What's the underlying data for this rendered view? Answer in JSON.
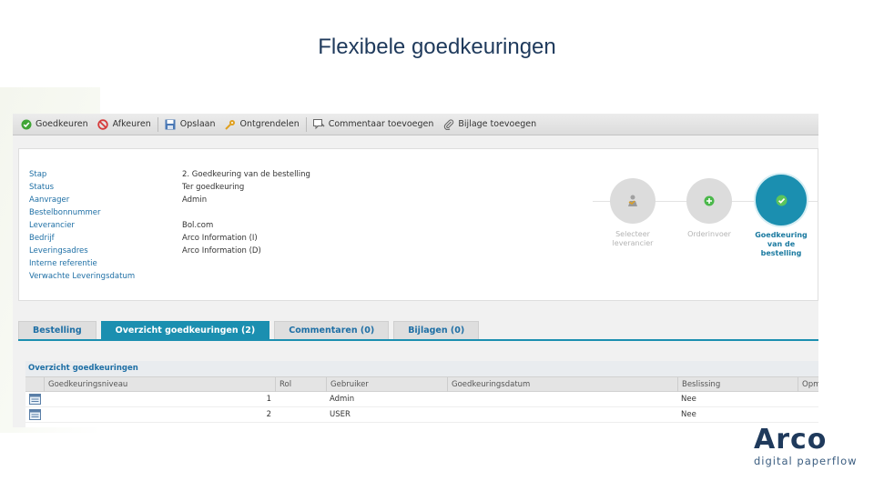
{
  "slide": {
    "title": "Flexibele goedkeuringen"
  },
  "toolbar": {
    "items": [
      {
        "label": "Goedkeuren",
        "icon": "check-circle-icon",
        "color": "#3fa535"
      },
      {
        "label": "Afkeuren",
        "icon": "no-entry-icon",
        "color": "#d63b3b"
      },
      {
        "label": "Opslaan",
        "icon": "save-icon",
        "color": "#4a78b5"
      },
      {
        "label": "Ontgrendelen",
        "icon": "unlock-icon",
        "color": "#e0a020"
      },
      {
        "label": "Commentaar toevoegen",
        "icon": "comment-icon",
        "color": "#666666"
      },
      {
        "label": "Bijlage toevoegen",
        "icon": "paperclip-icon",
        "color": "#666666"
      }
    ]
  },
  "info": {
    "rows": [
      {
        "label": "Stap",
        "value": "2. Goedkeuring van de bestelling"
      },
      {
        "label": "Status",
        "value": "Ter goedkeuring"
      },
      {
        "label": "Aanvrager",
        "value": "Admin"
      },
      {
        "label": "Bestelbonnummer",
        "value": ""
      },
      {
        "label": "Leverancier",
        "value": "Bol.com"
      },
      {
        "label": "Bedrijf",
        "value": "Arco Information (I)"
      },
      {
        "label": "Leveringsadres",
        "value": "Arco Information (D)"
      },
      {
        "label": "Interne referentie",
        "value": ""
      },
      {
        "label": "Verwachte Leveringsdatum",
        "value": ""
      }
    ]
  },
  "workflow": {
    "steps": [
      {
        "label_line1": "Selecteer",
        "label_line2": "leverancier",
        "label_line3": "",
        "state": "done",
        "icon": "person-hand-icon"
      },
      {
        "label_line1": "Orderinvoer",
        "label_line2": "",
        "label_line3": "",
        "state": "done",
        "icon": "plus-circle-icon"
      },
      {
        "label_line1": "Goedkeuring",
        "label_line2": "van de",
        "label_line3": "bestelling",
        "state": "active",
        "icon": "check-shield-icon"
      }
    ]
  },
  "tabs": [
    {
      "label": "Bestelling",
      "active": false
    },
    {
      "label": "Overzicht goedkeuringen (2)",
      "active": true
    },
    {
      "label": "Commentaren (0)",
      "active": false
    },
    {
      "label": "Bijlagen (0)",
      "active": false
    }
  ],
  "grid": {
    "title": "Overzicht goedkeuringen",
    "columns": [
      "Goedkeuringsniveau",
      "Rol",
      "Gebruiker",
      "Goedkeuringsdatum",
      "Beslissing",
      "Opm"
    ],
    "rows": [
      {
        "niveau": "1",
        "rol": "",
        "gebruiker": "Admin",
        "datum": "",
        "beslissing": "Nee"
      },
      {
        "niveau": "2",
        "rol": "",
        "gebruiker": "USER",
        "datum": "",
        "beslissing": "Nee"
      }
    ]
  },
  "logo": {
    "word": "Arco",
    "tagline": "digital paperflow",
    "color": "#1f3a5c"
  }
}
